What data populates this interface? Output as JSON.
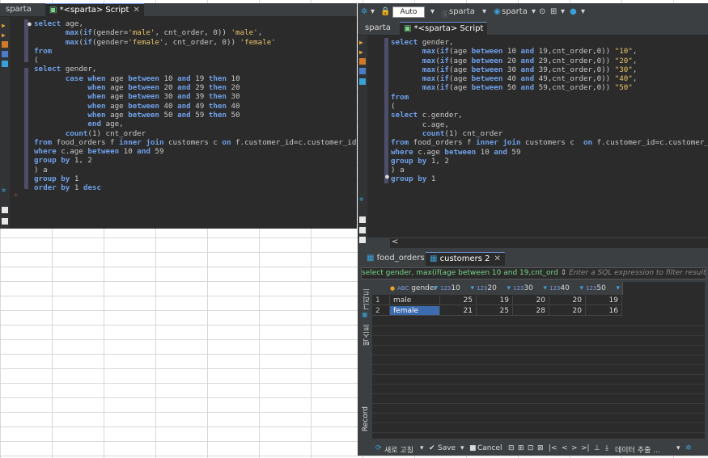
{
  "left_editor": {
    "tabs": [
      {
        "label": "sparta"
      },
      {
        "label": "*<sparta> Script",
        "close": "✕"
      }
    ],
    "lines": [
      "select age,",
      "       max(if(gender='male', cnt_order, 0)) 'male',",
      "       max(if(gender='female', cnt_order, 0)) 'female'",
      "from",
      "(",
      "select gender,",
      "       case when age between 10 and 19 then 10",
      "            when age between 20 and 29 then 20",
      "            when age between 30 and 39 then 30",
      "            when age between 40 and 49 then 40",
      "            when age between 50 and 59 then 50",
      "            end age,",
      "       count(1) cnt_order",
      "from food_orders f inner join customers c on f.customer_id=c.customer_id",
      "where c.age between 10 and 59",
      "group by 1, 2",
      ") a",
      "group by 1",
      "order by 1 desc"
    ]
  },
  "right_editor": {
    "toolbar": {
      "auto": "Auto",
      "datasource": "sparta",
      "schema": "sparta"
    },
    "tabs": [
      {
        "label": "sparta"
      },
      {
        "label": "*<sparta> Script"
      }
    ],
    "lines": [
      "select gender,",
      "       max(if(age between 10 and 19,cnt_order,0)) \"10\",",
      "       max(if(age between 20 and 29,cnt_order,0)) \"20\",",
      "       max(if(age between 30 and 39,cnt_order,0)) \"30\",",
      "       max(if(age between 40 and 49,cnt_order,0)) \"40\",",
      "       max(if(age between 50 and 59,cnt_order,0)) \"50\"",
      "from",
      "(",
      "select c.gender,",
      "       c.age,",
      "       count(1) cnt_order",
      "from food_orders f inner join customers c  on f.customer_id=c.customer_id",
      "where c.age between 10 and 59",
      "group by 1, 2",
      ") a",
      "group by 1"
    ],
    "scroll_left": "<"
  },
  "results": {
    "tabs": [
      {
        "label": "food_orders 1"
      },
      {
        "label": "customers 2",
        "close": "✕"
      }
    ],
    "filter_query": "select gender, max(if(age between 10 and 19,cnt_ord",
    "filter_placeholder": "Enter a SQL expression to filter results (use Ctrl+Space)",
    "side_tabs": {
      "grid": "그리드",
      "text": "텍스트",
      "record": "Record"
    },
    "columns": [
      "gender",
      "10",
      "20",
      "30",
      "40",
      "50"
    ],
    "rows": [
      {
        "n": "1",
        "gender": "male",
        "v": [
          "25",
          "19",
          "20",
          "20",
          "19"
        ]
      },
      {
        "n": "2",
        "gender": "female",
        "v": [
          "21",
          "25",
          "28",
          "20",
          "16"
        ]
      }
    ],
    "status": {
      "refresh": "새로 고침",
      "save": "Save",
      "cancel": "Cancel",
      "export": "데이터 추출 ..."
    }
  }
}
